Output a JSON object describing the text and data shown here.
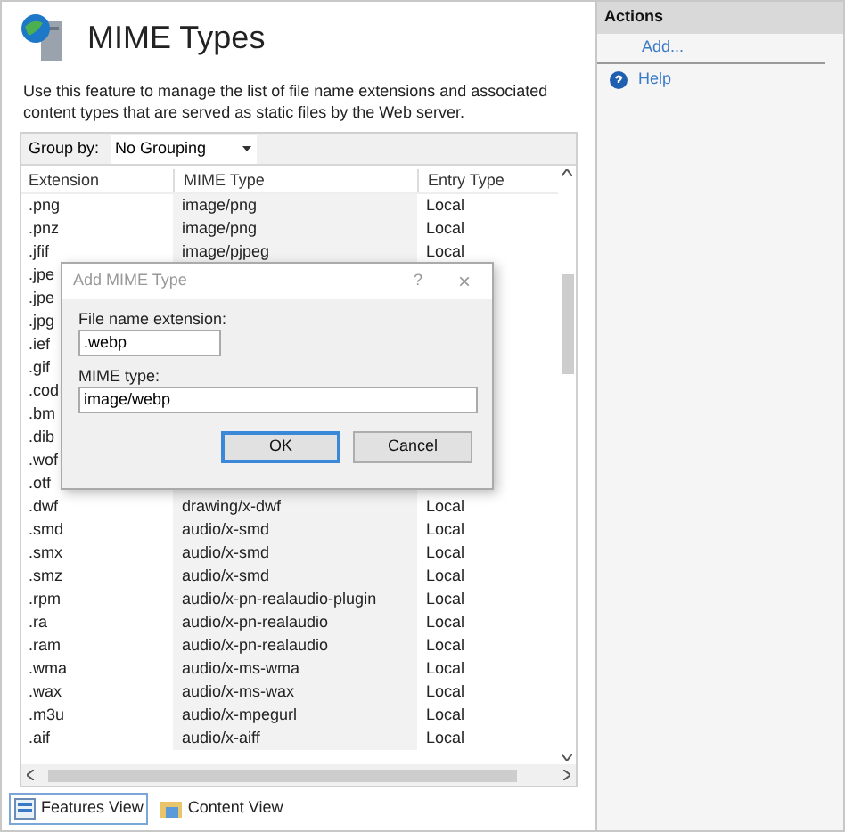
{
  "page": {
    "title": "MIME Types",
    "description": "Use this feature to manage the list of file name extensions and associated content types that are served as static files by the Web server."
  },
  "toolbar": {
    "group_by_label": "Group by:",
    "group_by_value": "No Grouping"
  },
  "table": {
    "columns": [
      "Extension",
      "MIME Type",
      "Entry Type"
    ],
    "rows": [
      {
        "extension": ".png",
        "mime_type": "image/png",
        "entry_type": "Local"
      },
      {
        "extension": ".pnz",
        "mime_type": "image/png",
        "entry_type": "Local"
      },
      {
        "extension": ".jfif",
        "mime_type": "image/pjpeg",
        "entry_type": "Local"
      },
      {
        "extension": ".jpe"
      },
      {
        "extension": ".jpe"
      },
      {
        "extension": ".jpg"
      },
      {
        "extension": ".ief"
      },
      {
        "extension": ".gif"
      },
      {
        "extension": ".cod"
      },
      {
        "extension": ".bm"
      },
      {
        "extension": ".dib"
      },
      {
        "extension": ".wof"
      },
      {
        "extension": ".otf"
      },
      {
        "extension": ".dwf",
        "mime_type": "drawing/x-dwf",
        "entry_type": "Local"
      },
      {
        "extension": ".smd",
        "mime_type": "audio/x-smd",
        "entry_type": "Local"
      },
      {
        "extension": ".smx",
        "mime_type": "audio/x-smd",
        "entry_type": "Local"
      },
      {
        "extension": ".smz",
        "mime_type": "audio/x-smd",
        "entry_type": "Local"
      },
      {
        "extension": ".rpm",
        "mime_type": "audio/x-pn-realaudio-plugin",
        "entry_type": "Local"
      },
      {
        "extension": ".ra",
        "mime_type": "audio/x-pn-realaudio",
        "entry_type": "Local"
      },
      {
        "extension": ".ram",
        "mime_type": "audio/x-pn-realaudio",
        "entry_type": "Local"
      },
      {
        "extension": ".wma",
        "mime_type": "audio/x-ms-wma",
        "entry_type": "Local"
      },
      {
        "extension": ".wax",
        "mime_type": "audio/x-ms-wax",
        "entry_type": "Local"
      },
      {
        "extension": ".m3u",
        "mime_type": "audio/x-mpegurl",
        "entry_type": "Local"
      },
      {
        "extension": ".aif",
        "mime_type": "audio/x-aiff",
        "entry_type": "Local"
      }
    ]
  },
  "view_tabs": [
    {
      "label": "Features View",
      "selected": true
    },
    {
      "label": "Content View",
      "selected": false
    }
  ],
  "actions": {
    "title": "Actions",
    "items": [
      {
        "label": "Add...",
        "kind": "link"
      },
      {
        "label": "Help",
        "kind": "help"
      }
    ]
  },
  "dialog": {
    "title": "Add MIME Type",
    "help": "?",
    "close": "×",
    "fields": [
      {
        "label": "File name extension:",
        "value": ".webp",
        "kind": "short"
      },
      {
        "label": "MIME type:",
        "value": "image/webp",
        "kind": "wide"
      }
    ],
    "buttons": [
      {
        "label": "OK",
        "default": true
      },
      {
        "label": "Cancel",
        "default": false
      }
    ]
  }
}
